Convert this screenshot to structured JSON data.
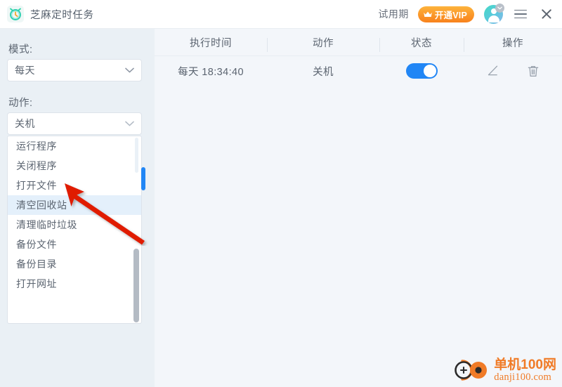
{
  "titlebar": {
    "app_icon": "alarm-clock-icon",
    "title": "芝麻定时任务",
    "trial_label": "试用期",
    "vip_button_label": "开通VIP",
    "vip_icon": "crown-icon",
    "avatar_icon": "user-avatar-icon",
    "avatar_badge_icon": "chevron-down-icon",
    "menu_icon": "hamburger-menu-icon",
    "close_icon": "close-icon",
    "vip_gradient_start": "#fdb33c",
    "vip_gradient_end": "#f8821d"
  },
  "left_panel": {
    "mode_label": "模式:",
    "mode_value": "每天",
    "action_label": "动作:",
    "action_value": "关机",
    "dropdown_chevron_icon": "chevron-down-icon",
    "action_options": [
      {
        "label": "运行程序",
        "selected": false
      },
      {
        "label": "关闭程序",
        "selected": false
      },
      {
        "label": "打开文件",
        "selected": false
      },
      {
        "label": "清空回收站",
        "selected": true
      },
      {
        "label": "清理临时垃圾",
        "selected": false
      },
      {
        "label": "备份文件",
        "selected": false
      },
      {
        "label": "备份目录",
        "selected": false
      },
      {
        "label": "打开网址",
        "selected": false
      }
    ],
    "highlight_color": "#e4f0fb",
    "scrollbar_color": "#2186f5"
  },
  "table": {
    "headers": [
      "执行时间",
      "动作",
      "状态",
      "操作"
    ],
    "rows": [
      {
        "time": "每天 18:34:40",
        "action": "关机",
        "enabled": true,
        "edit_icon": "edit-pencil-icon",
        "delete_icon": "trash-can-icon"
      }
    ],
    "toggle_on_color": "#2186f5"
  },
  "annotation": {
    "arrow_icon": "red-arrow-icon",
    "arrow_color": "#e01b00"
  },
  "watermark": {
    "logo_icon": "danji100-logo-icon",
    "site_name_cn": "单机100网",
    "site_url": "danji100.com",
    "color": "#f07b27"
  }
}
